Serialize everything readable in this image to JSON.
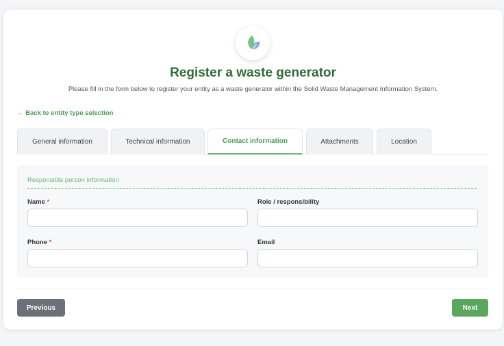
{
  "header": {
    "title": "Register a waste generator",
    "subtitle": "Please fill in the form below to register your entity as a waste generator within the Solid Waste Management Information System."
  },
  "nav": {
    "back_link": "← Back to entity type selection"
  },
  "tabs": [
    {
      "label": "General information",
      "active": false
    },
    {
      "label": "Technical information",
      "active": false
    },
    {
      "label": "Contact information",
      "active": true
    },
    {
      "label": "Attachments",
      "active": false
    },
    {
      "label": "Location",
      "active": false
    }
  ],
  "section": {
    "title": "Responsible person information",
    "fields": {
      "name": {
        "label": "Name",
        "required_mark": "*",
        "value": ""
      },
      "role": {
        "label": "Role / responsibility",
        "value": ""
      },
      "phone": {
        "label": "Phone",
        "required_mark": "*",
        "value": ""
      },
      "email": {
        "label": "Email",
        "value": ""
      }
    }
  },
  "buttons": {
    "previous": "Previous",
    "next": "Next"
  },
  "colors": {
    "brand_green": "#2f6b34",
    "accent_green": "#5aa75d",
    "required_red": "#d9534f",
    "button_gray": "#6c7079"
  },
  "icons": {
    "logo": "leaf-icon"
  }
}
